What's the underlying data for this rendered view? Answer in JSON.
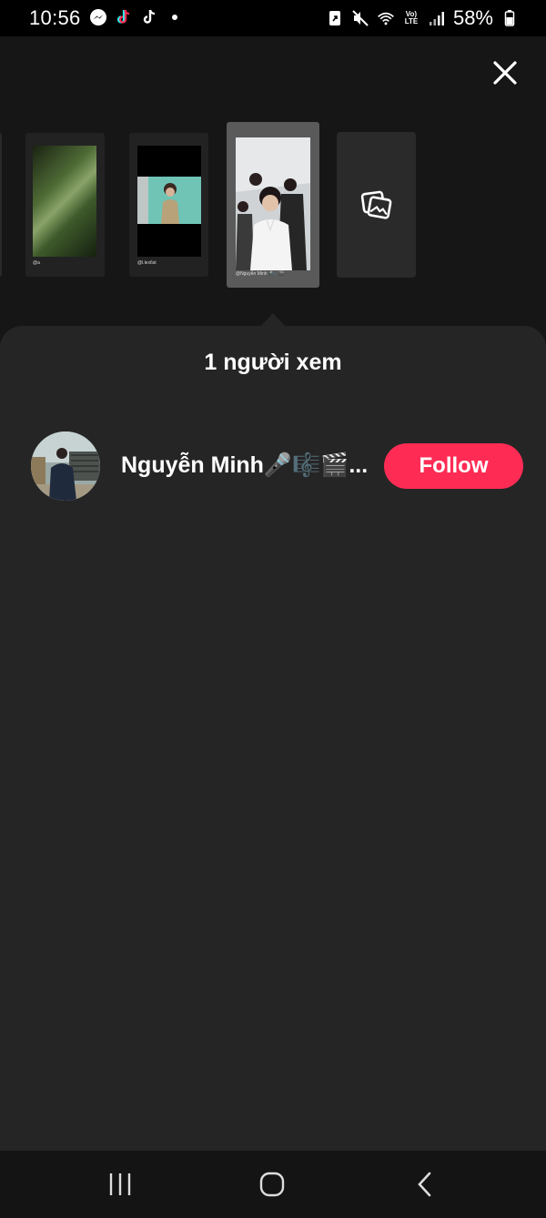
{
  "status_bar": {
    "time": "10:56",
    "left_icons": [
      "messenger-icon",
      "tiktok-lite-icon",
      "tiktok-icon",
      "notification-dot"
    ],
    "right_icons": [
      "save-icon",
      "mute-icon",
      "wifi-icon",
      "volte-icon",
      "signal-icon",
      "battery-icon"
    ],
    "volte_label": "Vo) LTE",
    "battery": "58%"
  },
  "header": {
    "close_icon": "close-icon"
  },
  "story_thumbnails": [
    {
      "caption": "@a"
    },
    {
      "caption": "@l.lex6st"
    },
    {
      "caption": "@Nguyễn Minh🎤🎼🎬",
      "selected": true
    },
    {
      "icon": "gallery-icon"
    }
  ],
  "sheet": {
    "title": "1 người xem",
    "viewers": [
      {
        "name": "Nguyễn Minh🎤🎼🎬...",
        "follow_label": "Follow"
      }
    ]
  },
  "nav_bar": {
    "icons": [
      "recents-icon",
      "home-icon",
      "back-icon"
    ]
  },
  "colors": {
    "accent": "#fe2c55",
    "sheet": "#252525",
    "background": "#161616"
  }
}
